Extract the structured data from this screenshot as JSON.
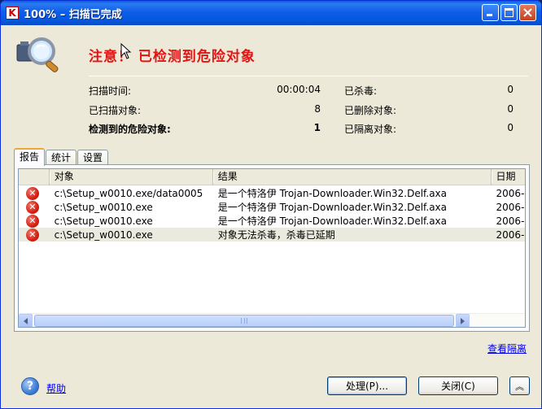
{
  "window": {
    "title": "100% – 扫描已完成",
    "app_icon_letter": "K"
  },
  "header": {
    "warning_title": "注意！ 已检测到危险对象"
  },
  "stats": {
    "scan_time_label": "扫描时间:",
    "scan_time_value": "00:00:04",
    "scanned_label": "已扫描对象:",
    "scanned_value": "8",
    "detected_label": "检测到的危险对象:",
    "detected_value": "1",
    "disinfected_label": "已杀毒:",
    "disinfected_value": "0",
    "deleted_label": "已删除对象:",
    "deleted_value": "0",
    "quarantined_label": "已隔离对象:",
    "quarantined_value": "0"
  },
  "tabs": [
    {
      "label": "报告",
      "active": true
    },
    {
      "label": "统计",
      "active": false
    },
    {
      "label": "设置",
      "active": false
    }
  ],
  "table": {
    "columns": [
      "对象",
      "结果",
      "日期"
    ],
    "rows": [
      {
        "object": "c:\\Setup_w0010.exe/data0005",
        "result": "是一个特洛伊 Trojan-Downloader.Win32.Delf.axa",
        "date": "2006-"
      },
      {
        "object": "c:\\Setup_w0010.exe",
        "result": "是一个特洛伊 Trojan-Downloader.Win32.Delf.axa",
        "date": "2006-"
      },
      {
        "object": "c:\\Setup_w0010.exe",
        "result": "是一个特洛伊 Trojan-Downloader.Win32.Delf.axa",
        "date": "2006-"
      },
      {
        "object": "c:\\Setup_w0010.exe",
        "result": "对象无法杀毒，杀毒已延期",
        "date": "2006-"
      }
    ]
  },
  "links": {
    "view_quarantine": "查看隔离",
    "help": "帮助"
  },
  "buttons": {
    "process": "处理(P)...",
    "close": "关闭(C)",
    "collapse": "︽"
  },
  "colors": {
    "warning": "#e31414",
    "titlebar": "#0558e0"
  }
}
